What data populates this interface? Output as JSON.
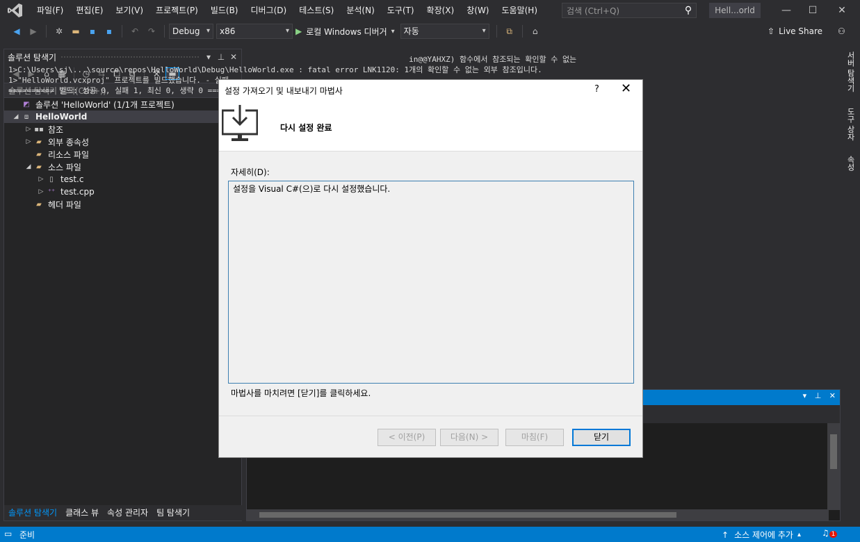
{
  "menu": {
    "items": [
      "파일(F)",
      "편집(E)",
      "보기(V)",
      "프로젝트(P)",
      "빌드(B)",
      "디버그(D)",
      "테스트(S)",
      "분석(N)",
      "도구(T)",
      "확장(X)",
      "창(W)",
      "도움말(H)"
    ],
    "search_placeholder": "검색 (Ctrl+Q)",
    "window_title": "Hell...orld"
  },
  "toolbar": {
    "config": "Debug",
    "platform": "x86",
    "run_label": "로컬 Windows 디버거",
    "run_mode": "자동",
    "live_share": "Live Share"
  },
  "solution_explorer": {
    "title": "솔루션 탐색기",
    "search_placeholder": "솔루션 탐색기 검색(Ctrl+;)",
    "tree": [
      {
        "label": "솔루션 'HelloWorld' (1/1개 프로젝트)",
        "indent": 0,
        "arrow": "",
        "icon": "solution-icon"
      },
      {
        "label": "HelloWorld",
        "indent": 0,
        "arrow": "◢",
        "icon": "project-icon",
        "bold": true,
        "selected": true
      },
      {
        "label": "참조",
        "indent": 1,
        "arrow": "▷",
        "icon": "references-icon"
      },
      {
        "label": "외부 종속성",
        "indent": 1,
        "arrow": "▷",
        "icon": "folder-icon"
      },
      {
        "label": "리소스 파일",
        "indent": 1,
        "arrow": "",
        "icon": "folder-icon"
      },
      {
        "label": "소스 파일",
        "indent": 1,
        "arrow": "◢",
        "icon": "folder-icon"
      },
      {
        "label": "test.c",
        "indent": 2,
        "arrow": "▷",
        "icon": "c-file-icon"
      },
      {
        "label": "test.cpp",
        "indent": 2,
        "arrow": "▷",
        "icon": "cpp-file-icon"
      },
      {
        "label": "헤더 파일",
        "indent": 1,
        "arrow": "",
        "icon": "folder-icon"
      }
    ],
    "tabs": [
      "솔루션 탐색기",
      "클래스 뷰",
      "속성 관리자",
      "팀 탐색기"
    ]
  },
  "right_tabs": [
    "서버 탐색기",
    "도구 상자",
    "속성"
  ],
  "output": {
    "lines": [
      "                                                                                       in@@YAHXZ) 함수에서 참조되는 확인할 수 없는",
      "1>C:\\Users\\sj\\...\\source\\repos\\HelloWorld\\Debug\\HelloWorld.exe : fatal error LNK1120: 1개의 확인할 수 없는 외부 참조입니다.",
      "1>\"HelloWorld.vcxproj\" 프로젝트를 빌드했습니다. - 실패",
      "========== 빌드: 성공 0, 실패 1, 최신 0, 생략 0 =========="
    ]
  },
  "statusbar": {
    "ready": "준비",
    "source_control": "소스 제어에 추가",
    "notification_count": "1"
  },
  "dialog": {
    "title": "설정 가져오기 및 내보내기 마법사",
    "help": "?",
    "banner_title": "다시 설정 완료",
    "detail_label": "자세히(D):",
    "detail_text": "설정을 Visual C#(으)로 다시 설정했습니다.",
    "hint": "마법사를 마치려면 [닫기]를 클릭하세요.",
    "buttons": {
      "prev": "< 이전(P)",
      "next": "다음(N) >",
      "finish": "마침(F)",
      "close": "닫기"
    }
  },
  "colors": {
    "accent": "#007acc",
    "background": "#2d2d30"
  }
}
